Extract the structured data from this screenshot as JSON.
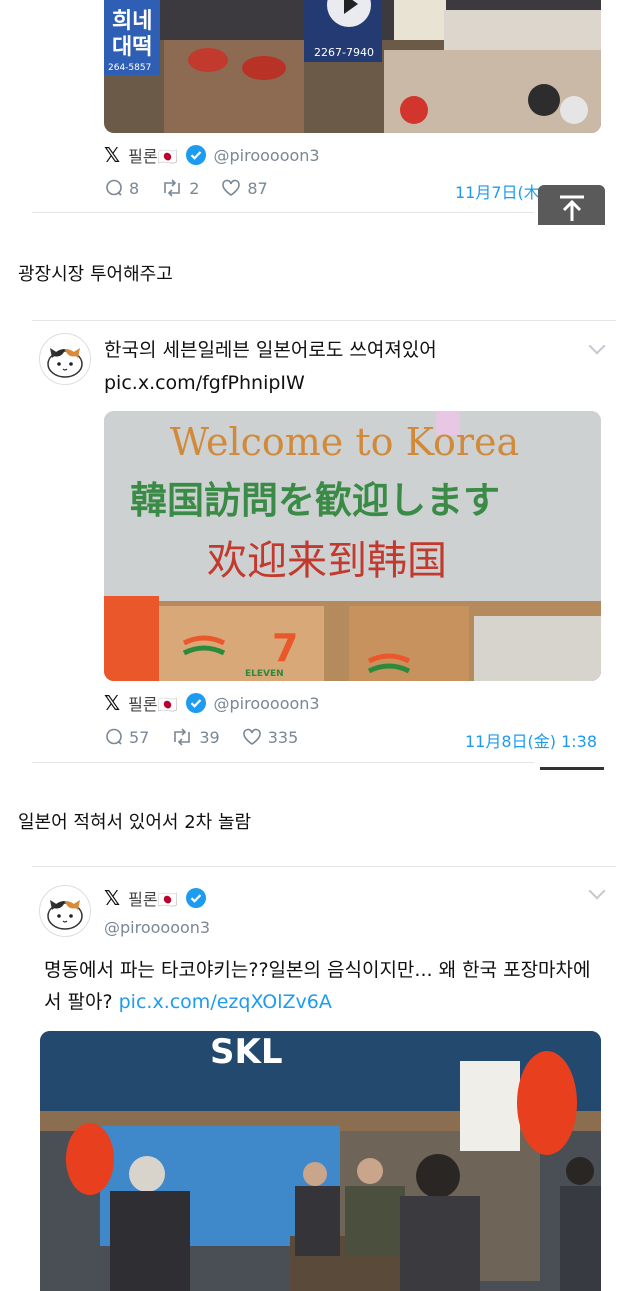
{
  "tweet1": {
    "name": "필론🇯🇵",
    "handle": "@pirooooon3",
    "replies": "8",
    "retweets": "2",
    "likes": "87",
    "date": "11月7日(木) 17:03",
    "photo_signs": [
      "희네",
      "대떡",
      "264-5857",
      "2267-7940"
    ]
  },
  "caption1": "광장시장 투어해주고",
  "tweet2": {
    "text": "한국의 세븐일레븐 일본어로도 쓰여져있어",
    "link": "pic.x.com/fgfPhnipIW",
    "sign_line1": "Welcome to Korea",
    "sign_line2": "韓国訪問を歓迎します",
    "sign_line3": "欢迎来到韩国",
    "store_logo": "ELEVEN",
    "name": "필론🇯🇵",
    "handle": "@pirooooon3",
    "replies": "57",
    "retweets": "39",
    "likes": "335",
    "date": "11月8日(金) 1:38"
  },
  "caption2": "일본어 적혀서 있어서 2차 놀람",
  "tweet3": {
    "name": "필론🇯🇵",
    "handle": "@pirooooon3",
    "text": "명동에서 파는 타코야키는??일본의 음식이지만... 왜 한국 포장마차에서 팔아?",
    "link": "pic.x.com/ezqXOlZv6A",
    "store_sign": "SKL"
  },
  "colors": {
    "link": "#1d9bf0",
    "verified": "#1d9bf0",
    "muted": "#7a8794"
  }
}
